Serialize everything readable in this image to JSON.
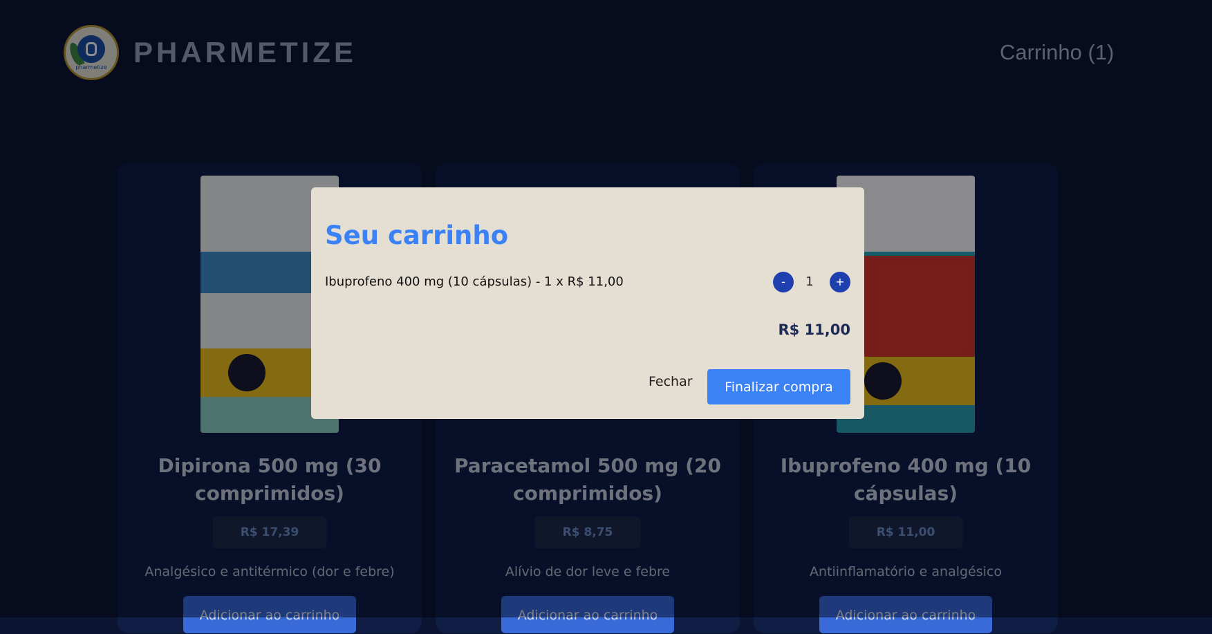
{
  "header": {
    "brand": "PHARMETIZE",
    "logo_text": "pharmetize",
    "cart_label": "Carrinho (1)"
  },
  "products": [
    {
      "title": "Dipirona 500 mg (30 comprimidos)",
      "price": "R$ 17,39",
      "description": "Analgésico e antitérmico (dor e febre)",
      "button": "Adicionar ao carrinho"
    },
    {
      "title": "Paracetamol 500 mg (20 comprimidos)",
      "price": "R$ 8,75",
      "description": "Alívio de dor leve e febre",
      "button": "Adicionar ao carrinho"
    },
    {
      "title": "Ibuprofeno 400 mg (10 cápsulas)",
      "price": "R$ 11,00",
      "description": "Antiinflamatório e analgésico",
      "button": "Adicionar ao carrinho"
    }
  ],
  "cart_modal": {
    "title": "Seu carrinho",
    "items": [
      {
        "text": "Ibuprofeno 400 mg (10 cápsulas) - 1 x R$ 11,00",
        "quantity": "1",
        "minus_label": "-",
        "plus_label": "+"
      }
    ],
    "total": "R$ 11,00",
    "close_label": "Fechar",
    "finish_label": "Finalizar compra"
  },
  "colors": {
    "background": "#0b1430",
    "accent": "#3b82f6",
    "modal_background": "#e5ded3",
    "qty_button": "#1e40af"
  }
}
